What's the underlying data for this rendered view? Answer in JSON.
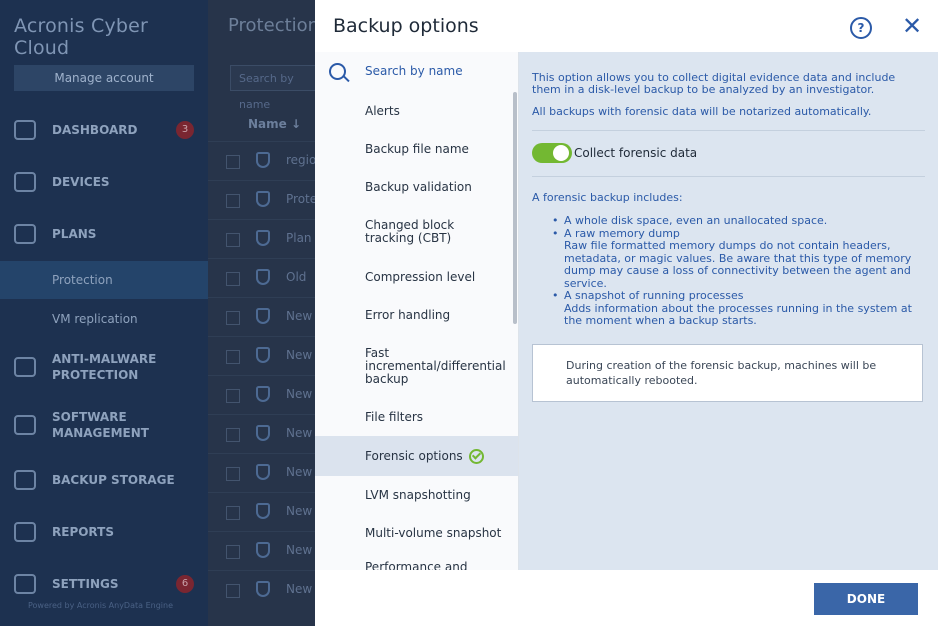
{
  "app": {
    "brand": "Acronis Cyber Cloud",
    "manage_account": "Manage account",
    "footer": "Powered by Acronis AnyData Engine"
  },
  "sidebar": {
    "items": [
      {
        "label": "DASHBOARD",
        "badge": "3"
      },
      {
        "label": "DEVICES"
      },
      {
        "label": "PLANS"
      },
      {
        "label": "ANTI-MALWARE PROTECTION"
      },
      {
        "label": "SOFTWARE MANAGEMENT"
      },
      {
        "label": "BACKUP STORAGE"
      },
      {
        "label": "REPORTS"
      },
      {
        "label": "SETTINGS",
        "badge": "6"
      }
    ],
    "sub_items": [
      "Protection",
      "VM replication"
    ]
  },
  "main": {
    "title": "Protection",
    "search_placeholder": "Search by name",
    "column_name": "Name",
    "rows": [
      "regio",
      "Prote",
      "Plan",
      "Old",
      "New",
      "New",
      "New",
      "New",
      "New",
      "New",
      "New",
      "New"
    ]
  },
  "dialog": {
    "title": "Backup options",
    "search_placeholder": "Search by name",
    "options": [
      "Alerts",
      "Backup file name",
      "Backup validation",
      "Changed block tracking (CBT)",
      "Compression level",
      "Error handling",
      "Fast incremental/differential backup",
      "File filters",
      "Forensic options",
      "LVM snapshotting",
      "Multi-volume snapshot",
      "Performance and backup"
    ],
    "selected_index": 8,
    "description": "This option allows you to collect digital evidence data and include them in a disk-level backup to be analyzed by an investigator.",
    "description2": "All backups with forensic data will be notarized automatically.",
    "toggle_label": "Collect forensic data",
    "toggle_on": true,
    "includes_title": "A forensic backup includes:",
    "includes": [
      {
        "main": "A whole disk space, even an unallocated space.",
        "extra": ""
      },
      {
        "main": "A raw memory dump",
        "extra": "Raw file formatted memory dumps do not contain headers, metadata, or magic values. Be aware that this type of memory dump may cause a loss of connectivity between the agent and service."
      },
      {
        "main": "A snapshot of running processes",
        "extra": "Adds information about the processes running in the system at the moment when a backup starts."
      }
    ],
    "notice": "During creation of the forensic backup, machines will be automatically rebooted.",
    "done_label": "DONE"
  },
  "colors": {
    "accent": "#2b5aa8",
    "toggle_on": "#73b832",
    "selected_bg": "#dbe3ee",
    "right_pane_bg": "#dce5f0",
    "done_button": "#3a66a8"
  }
}
